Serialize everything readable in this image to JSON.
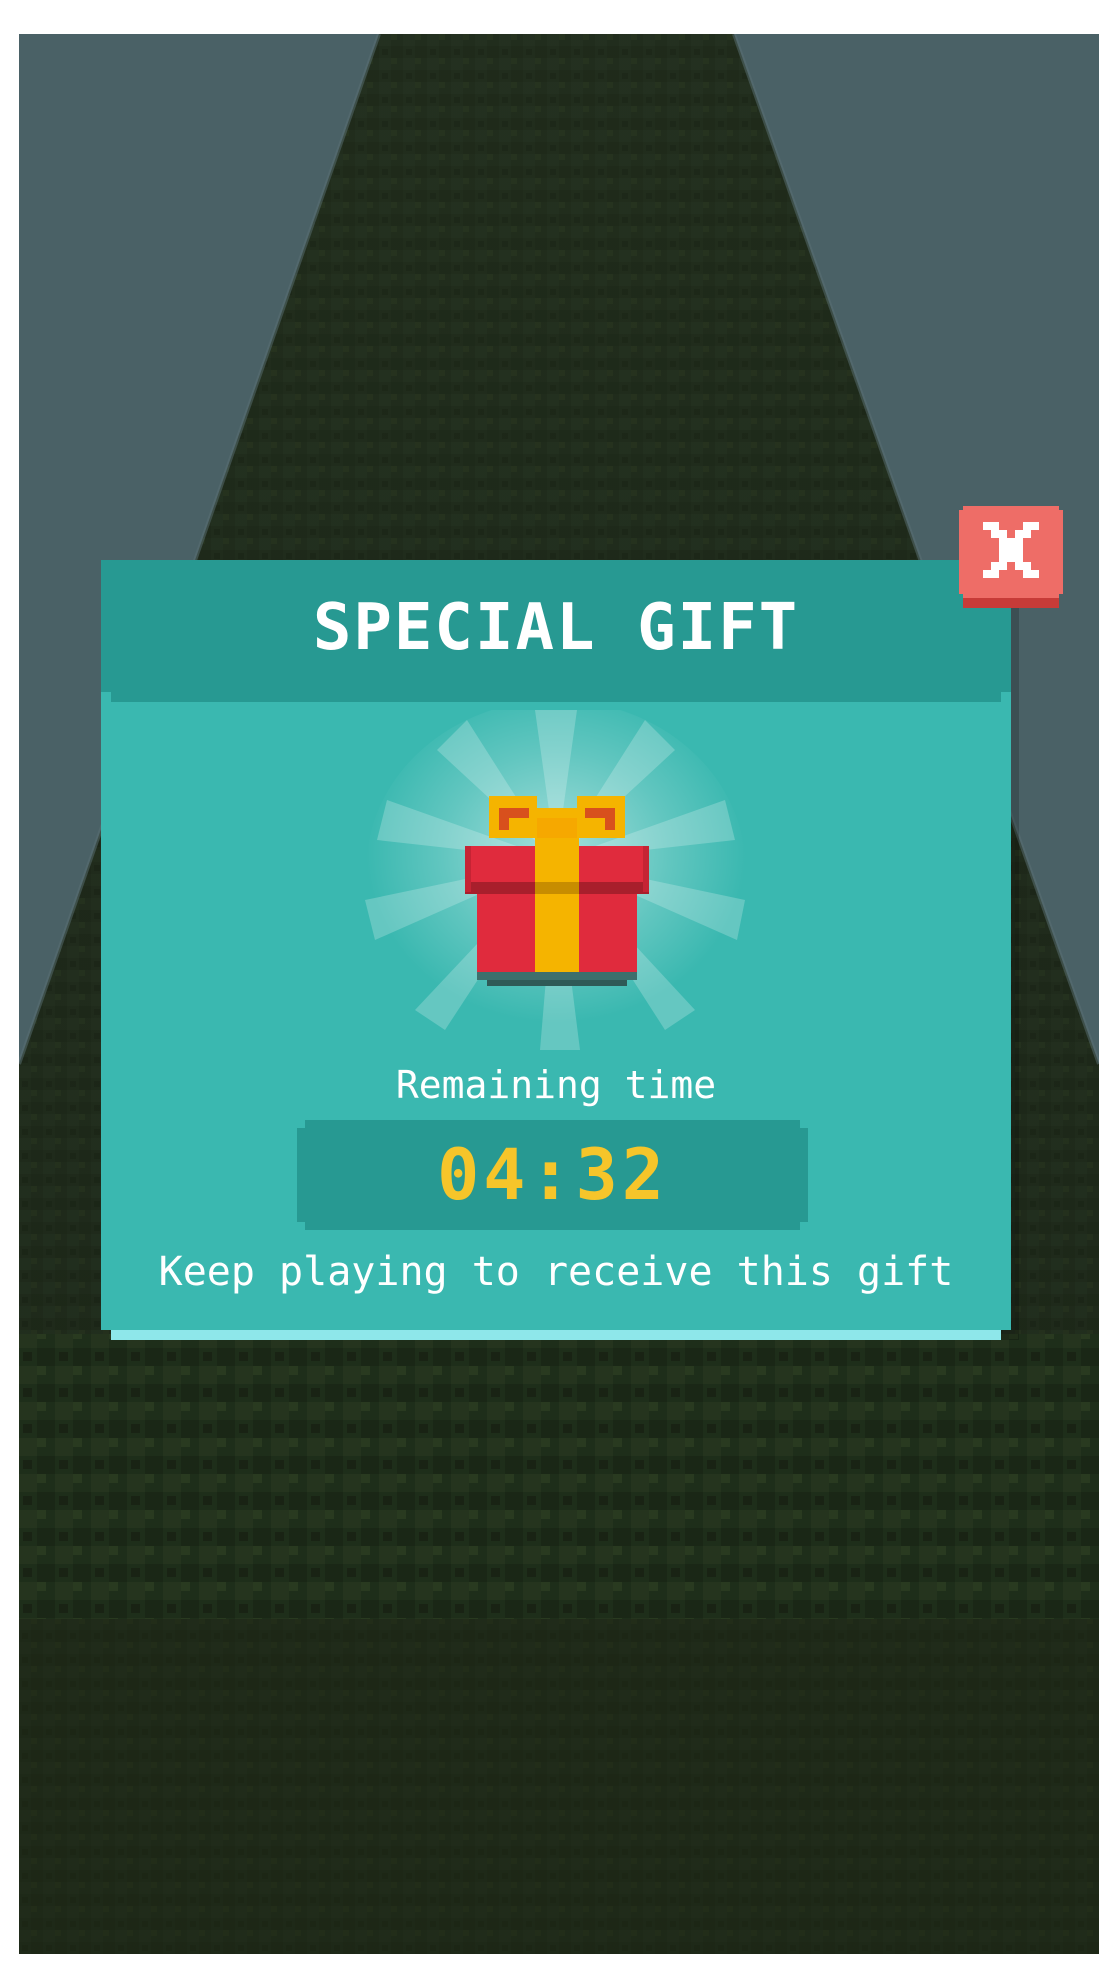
{
  "popup": {
    "title": "SPECIAL GIFT",
    "remaining_label": "Remaining time",
    "timer": "04:32",
    "hint": "Keep playing to receive this gift"
  },
  "icons": {
    "gift": "gift-box-icon",
    "close": "close-x-icon"
  },
  "colors": {
    "panel": "#3ab8b0",
    "header": "#279992",
    "timer_text": "#f6c52a",
    "close_button": "#ee6d67",
    "gift_red": "#e02b3d",
    "gift_ribbon": "#f5b400"
  }
}
